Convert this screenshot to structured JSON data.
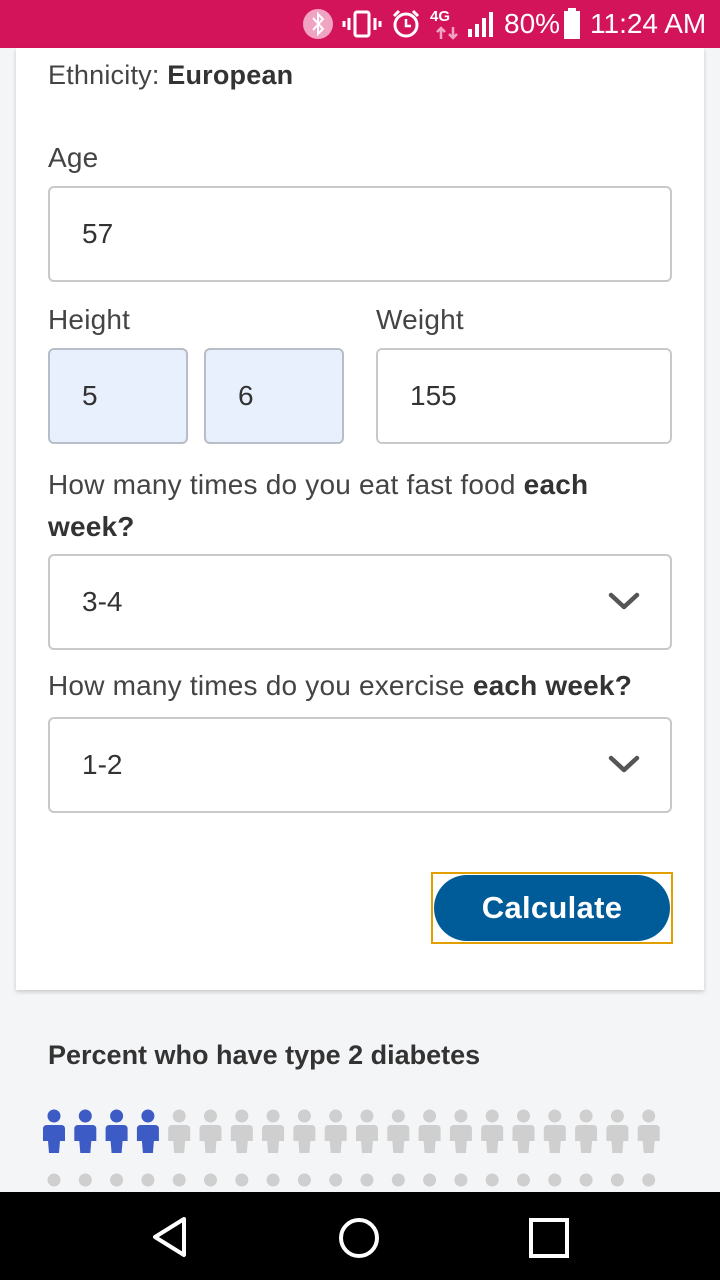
{
  "status_bar": {
    "network": "4G",
    "battery": "80%",
    "time": "11:24 AM",
    "icons": [
      "bluetooth-icon",
      "vibrate-icon",
      "alarm-icon",
      "lte-icon",
      "signal-icon",
      "battery-icon"
    ]
  },
  "form": {
    "ethnicity_label": "Ethnicity:",
    "ethnicity_value": "European",
    "age_label": "Age",
    "age_value": "57",
    "height_label": "Height",
    "height_feet": "5",
    "height_inches": "6",
    "weight_label": "Weight",
    "weight_value": "155",
    "fastfood_q_prefix": "How many times do you eat fast food",
    "fastfood_q_bold1": "each",
    "fastfood_q_bold2": "week?",
    "fastfood_value": "3-4",
    "exercise_q_prefix": "How many times do you exercise",
    "exercise_q_bold": "each week?",
    "exercise_value": "1-2",
    "calculate_label": "Calculate"
  },
  "result": {
    "title": "Percent who have type 2 diabetes",
    "highlighted_count": 4,
    "total_in_row": 20,
    "colors": {
      "highlighted": "#3d5bc4",
      "other": "#cfcfcf"
    }
  },
  "nav_bar": {
    "icons": [
      "back-icon",
      "home-icon",
      "recents-icon"
    ]
  },
  "colors": {
    "status_bar": "#d4145a",
    "button": "#005b99",
    "focus_outline": "#e2a000"
  }
}
